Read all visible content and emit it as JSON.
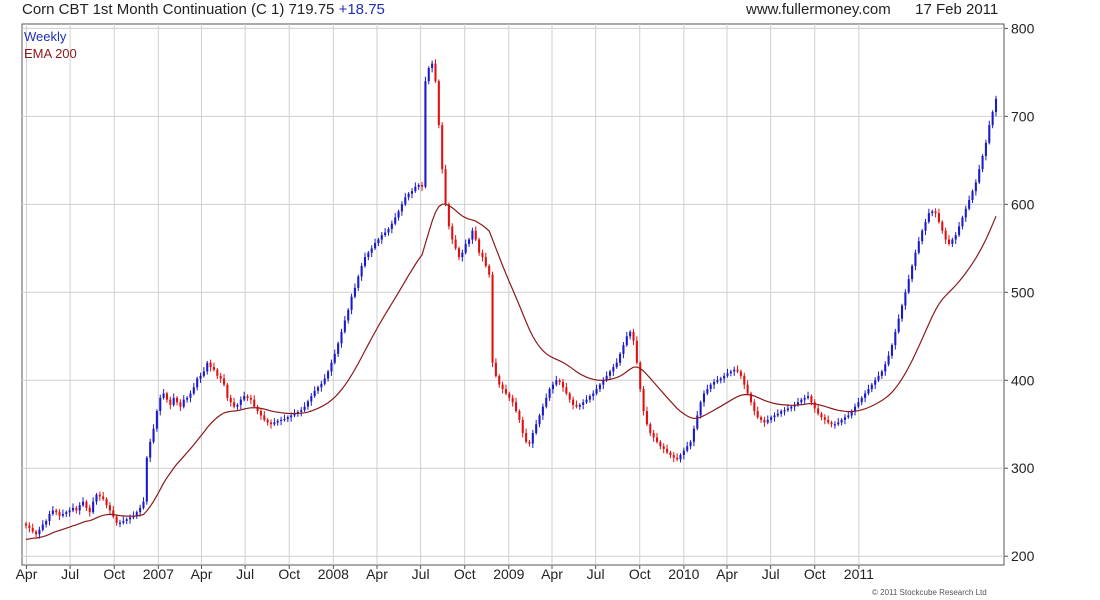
{
  "header": {
    "instrument": "Corn CBT 1st Month Continuation (C 1)",
    "last_price": "719.75",
    "change": "+18.75",
    "website": "www.fullermoney.com",
    "date": "17 Feb 2011"
  },
  "legend": {
    "weekly": "Weekly",
    "ema": "EMA 200"
  },
  "copyright": "© 2011 Stockcube Research Ltd",
  "colors": {
    "up": "#1a1acc",
    "down": "#e01010",
    "ema": "#8b1a1a",
    "grid": "#cfcfcf",
    "frame": "#555555",
    "weekly_label": "#1f2fb0"
  },
  "chart_data": {
    "type": "candlestick",
    "frequency": "weekly",
    "y_axis": {
      "position": "right",
      "ylim": [
        190,
        805
      ],
      "ticks": [
        200,
        300,
        400,
        500,
        600,
        700,
        800
      ]
    },
    "x_labels": [
      "Apr",
      "Jul",
      "Oct",
      "2007",
      "Apr",
      "Jul",
      "Oct",
      "2008",
      "Apr",
      "Jul",
      "Oct",
      "2009",
      "Apr",
      "Jul",
      "Oct",
      "2010",
      "Apr",
      "Jul",
      "Oct",
      "2011"
    ],
    "start_date": "2006-03-31",
    "week_step": 1,
    "weekly_close": [
      235,
      232,
      228,
      225,
      230,
      236,
      240,
      248,
      252,
      250,
      246,
      248,
      250,
      252,
      255,
      252,
      258,
      262,
      255,
      250,
      262,
      270,
      268,
      265,
      258,
      252,
      245,
      238,
      238,
      240,
      242,
      244,
      246,
      250,
      255,
      262,
      312,
      330,
      345,
      365,
      380,
      385,
      378,
      372,
      380,
      375,
      370,
      378,
      380,
      385,
      392,
      402,
      405,
      410,
      420,
      415,
      412,
      405,
      402,
      395,
      380,
      375,
      370,
      372,
      378,
      382,
      380,
      378,
      370,
      365,
      360,
      355,
      352,
      350,
      352,
      354,
      355,
      356,
      358,
      360,
      362,
      364,
      366,
      370,
      376,
      382,
      388,
      392,
      396,
      402,
      410,
      420,
      430,
      442,
      455,
      468,
      480,
      495,
      505,
      518,
      530,
      540,
      545,
      550,
      556,
      560,
      565,
      568,
      572,
      578,
      585,
      592,
      600,
      608,
      612,
      615,
      620,
      622,
      620,
      740,
      755,
      760,
      740,
      690,
      640,
      600,
      575,
      560,
      550,
      540,
      545,
      555,
      560,
      570,
      560,
      545,
      540,
      530,
      520,
      420,
      405,
      395,
      390,
      385,
      380,
      375,
      365,
      355,
      340,
      330,
      328,
      340,
      350,
      360,
      370,
      380,
      390,
      395,
      400,
      398,
      392,
      385,
      378,
      372,
      370,
      372,
      375,
      378,
      382,
      385,
      390,
      395,
      400,
      405,
      410,
      415,
      420,
      430,
      440,
      450,
      455,
      445,
      420,
      390,
      365,
      350,
      340,
      335,
      330,
      325,
      322,
      318,
      315,
      312,
      310,
      315,
      320,
      325,
      330,
      345,
      360,
      375,
      385,
      390,
      395,
      398,
      400,
      402,
      405,
      408,
      410,
      412,
      410,
      405,
      395,
      385,
      375,
      365,
      358,
      355,
      352,
      355,
      358,
      360,
      362,
      365,
      366,
      368,
      370,
      372,
      375,
      378,
      380,
      382,
      375,
      368,
      362,
      358,
      355,
      352,
      350,
      350,
      352,
      355,
      358,
      360,
      365,
      370,
      375,
      380,
      385,
      390,
      395,
      400,
      405,
      410,
      418,
      428,
      440,
      455,
      470,
      485,
      500,
      515,
      530,
      545,
      558,
      570,
      580,
      590,
      592,
      590,
      580,
      570,
      560,
      555,
      560,
      565,
      575,
      585,
      595,
      605,
      615,
      625,
      640,
      655,
      670,
      690,
      705,
      720
    ]
  }
}
